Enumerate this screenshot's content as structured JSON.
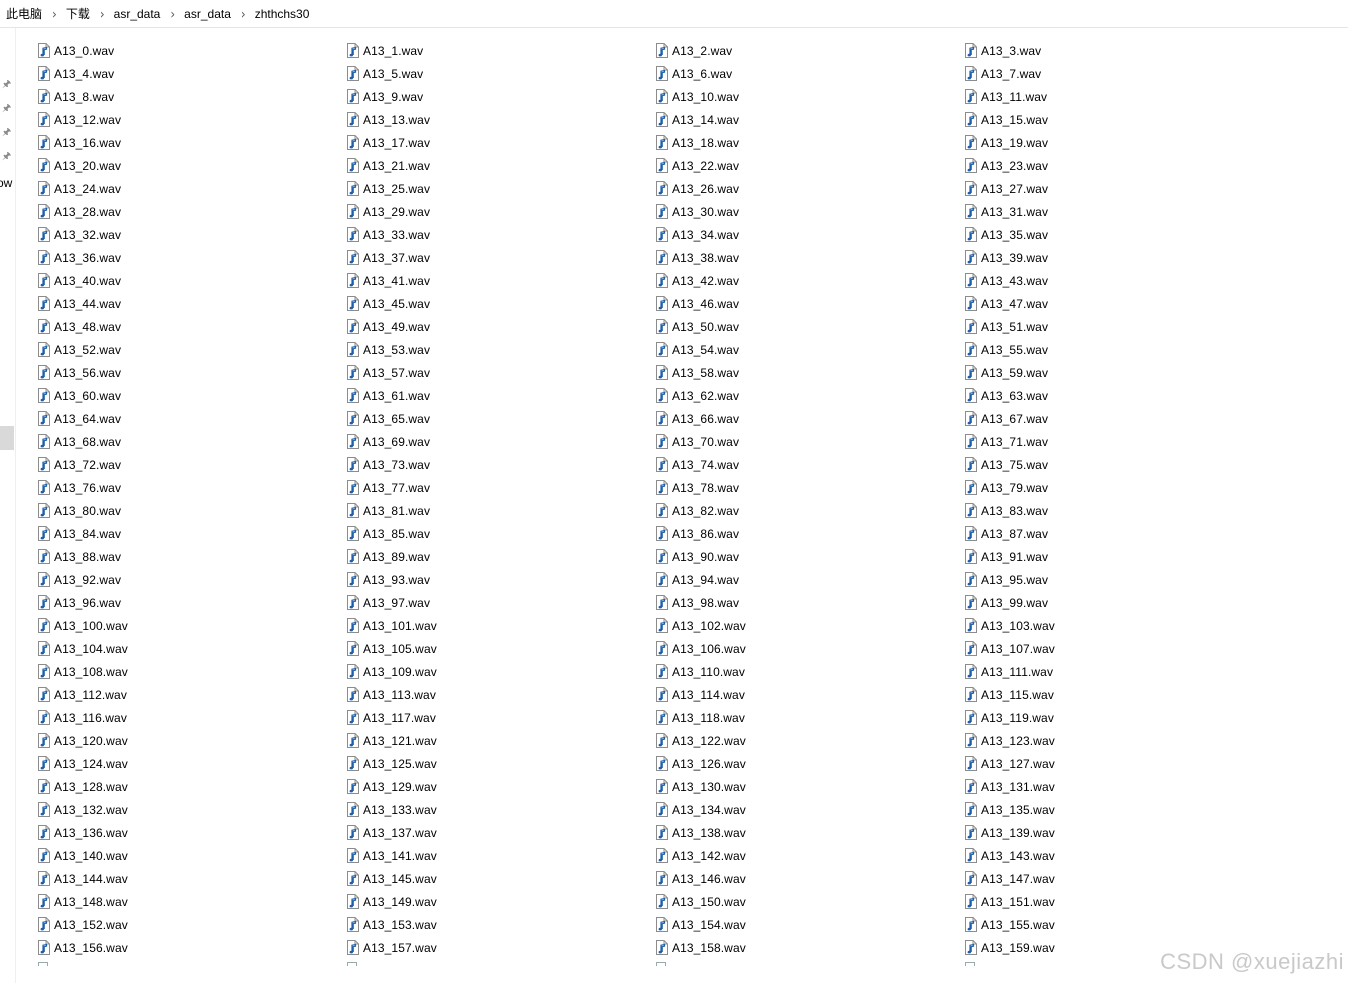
{
  "breadcrumb": {
    "items": [
      {
        "label": "此电脑"
      },
      {
        "label": "下载"
      },
      {
        "label": "asr_data"
      },
      {
        "label": "asr_data"
      },
      {
        "label": "zhthchs30"
      }
    ],
    "separator": "›"
  },
  "nav": {
    "partial_label": "ow"
  },
  "files": [
    "A13_0.wav",
    "A13_1.wav",
    "A13_2.wav",
    "A13_3.wav",
    "A13_4.wav",
    "A13_5.wav",
    "A13_6.wav",
    "A13_7.wav",
    "A13_8.wav",
    "A13_9.wav",
    "A13_10.wav",
    "A13_11.wav",
    "A13_12.wav",
    "A13_13.wav",
    "A13_14.wav",
    "A13_15.wav",
    "A13_16.wav",
    "A13_17.wav",
    "A13_18.wav",
    "A13_19.wav",
    "A13_20.wav",
    "A13_21.wav",
    "A13_22.wav",
    "A13_23.wav",
    "A13_24.wav",
    "A13_25.wav",
    "A13_26.wav",
    "A13_27.wav",
    "A13_28.wav",
    "A13_29.wav",
    "A13_30.wav",
    "A13_31.wav",
    "A13_32.wav",
    "A13_33.wav",
    "A13_34.wav",
    "A13_35.wav",
    "A13_36.wav",
    "A13_37.wav",
    "A13_38.wav",
    "A13_39.wav",
    "A13_40.wav",
    "A13_41.wav",
    "A13_42.wav",
    "A13_43.wav",
    "A13_44.wav",
    "A13_45.wav",
    "A13_46.wav",
    "A13_47.wav",
    "A13_48.wav",
    "A13_49.wav",
    "A13_50.wav",
    "A13_51.wav",
    "A13_52.wav",
    "A13_53.wav",
    "A13_54.wav",
    "A13_55.wav",
    "A13_56.wav",
    "A13_57.wav",
    "A13_58.wav",
    "A13_59.wav",
    "A13_60.wav",
    "A13_61.wav",
    "A13_62.wav",
    "A13_63.wav",
    "A13_64.wav",
    "A13_65.wav",
    "A13_66.wav",
    "A13_67.wav",
    "A13_68.wav",
    "A13_69.wav",
    "A13_70.wav",
    "A13_71.wav",
    "A13_72.wav",
    "A13_73.wav",
    "A13_74.wav",
    "A13_75.wav",
    "A13_76.wav",
    "A13_77.wav",
    "A13_78.wav",
    "A13_79.wav",
    "A13_80.wav",
    "A13_81.wav",
    "A13_82.wav",
    "A13_83.wav",
    "A13_84.wav",
    "A13_85.wav",
    "A13_86.wav",
    "A13_87.wav",
    "A13_88.wav",
    "A13_89.wav",
    "A13_90.wav",
    "A13_91.wav",
    "A13_92.wav",
    "A13_93.wav",
    "A13_94.wav",
    "A13_95.wav",
    "A13_96.wav",
    "A13_97.wav",
    "A13_98.wav",
    "A13_99.wav",
    "A13_100.wav",
    "A13_101.wav",
    "A13_102.wav",
    "A13_103.wav",
    "A13_104.wav",
    "A13_105.wav",
    "A13_106.wav",
    "A13_107.wav",
    "A13_108.wav",
    "A13_109.wav",
    "A13_110.wav",
    "A13_111.wav",
    "A13_112.wav",
    "A13_113.wav",
    "A13_114.wav",
    "A13_115.wav",
    "A13_116.wav",
    "A13_117.wav",
    "A13_118.wav",
    "A13_119.wav",
    "A13_120.wav",
    "A13_121.wav",
    "A13_122.wav",
    "A13_123.wav",
    "A13_124.wav",
    "A13_125.wav",
    "A13_126.wav",
    "A13_127.wav",
    "A13_128.wav",
    "A13_129.wav",
    "A13_130.wav",
    "A13_131.wav",
    "A13_132.wav",
    "A13_133.wav",
    "A13_134.wav",
    "A13_135.wav",
    "A13_136.wav",
    "A13_137.wav",
    "A13_138.wav",
    "A13_139.wav",
    "A13_140.wav",
    "A13_141.wav",
    "A13_142.wav",
    "A13_143.wav",
    "A13_144.wav",
    "A13_145.wav",
    "A13_146.wav",
    "A13_147.wav",
    "A13_148.wav",
    "A13_149.wav",
    "A13_150.wav",
    "A13_151.wav",
    "A13_152.wav",
    "A13_153.wav",
    "A13_154.wav",
    "A13_155.wav",
    "A13_156.wav",
    "A13_157.wav",
    "A13_158.wav",
    "A13_159.wav"
  ],
  "file_icon": "audio-file-icon",
  "watermark": "CSDN @xuejiazhi",
  "colors": {
    "icon_note": "#1e5fa8",
    "icon_page": "#ffffff",
    "icon_border": "#8c8c8c"
  }
}
